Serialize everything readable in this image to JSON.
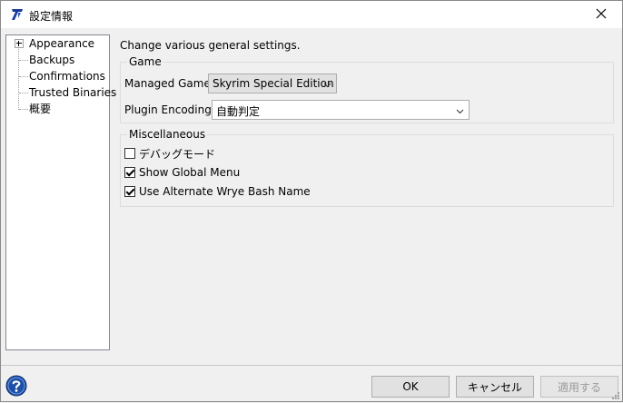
{
  "window": {
    "title": "設定情報"
  },
  "tree": {
    "items": [
      {
        "label": "Appearance"
      },
      {
        "label": "Backups"
      },
      {
        "label": "Confirmations"
      },
      {
        "label": "Trusted Binaries"
      },
      {
        "label": "概要"
      }
    ]
  },
  "main": {
    "heading": "Change various general settings.",
    "game_group": {
      "title": "Game",
      "managed_game_label": "Managed Game:",
      "managed_game_value": "Skyrim Special Edition",
      "plugin_encoding_label": "Plugin Encoding:",
      "plugin_encoding_value": "自動判定"
    },
    "misc_group": {
      "title": "Miscellaneous",
      "checkboxes": [
        {
          "label": "デバッグモード",
          "checked": false
        },
        {
          "label": "Show Global Menu",
          "checked": true
        },
        {
          "label": "Use Alternate Wrye Bash Name",
          "checked": true
        }
      ]
    }
  },
  "footer": {
    "ok_label": "OK",
    "cancel_label": "キャンセル",
    "apply_label": "適用する"
  }
}
